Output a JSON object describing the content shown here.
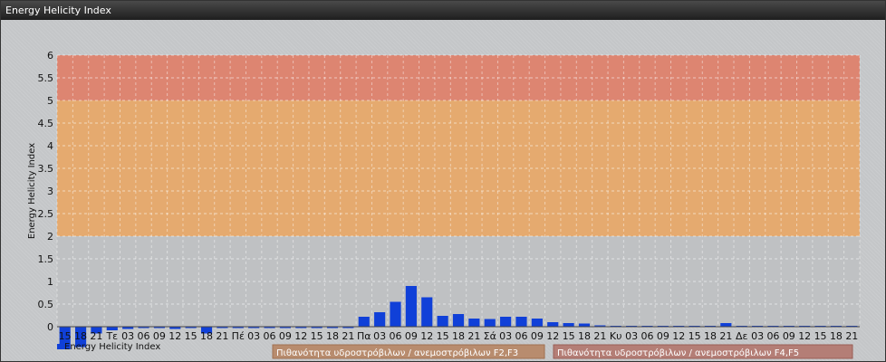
{
  "window": {
    "title": "Energy Helicity Index"
  },
  "chart_data": {
    "type": "bar",
    "ylabel": "Energy Helicity Index",
    "ylim": [
      0,
      6
    ],
    "yticks": [
      "0",
      "0.5",
      "1",
      "1.5",
      "2",
      "2.5",
      "3",
      "3.5",
      "4",
      "4.5",
      "5",
      "5.5",
      "6"
    ],
    "categories": [
      "15",
      "18",
      "21",
      "Τε",
      "03",
      "06",
      "09",
      "12",
      "15",
      "18",
      "21",
      "Πέ",
      "03",
      "06",
      "09",
      "12",
      "15",
      "18",
      "21",
      "Πα",
      "03",
      "06",
      "09",
      "12",
      "15",
      "18",
      "21",
      "Σά",
      "03",
      "06",
      "09",
      "12",
      "15",
      "18",
      "21",
      "Κυ",
      "03",
      "06",
      "09",
      "12",
      "15",
      "18",
      "21",
      "Δε",
      "03",
      "06",
      "09",
      "12",
      "15",
      "18",
      "21"
    ],
    "series": [
      {
        "name": "Energy Helicity Index",
        "color": "#1040d8",
        "values": [
          -0.5,
          -0.45,
          -0.15,
          -0.08,
          -0.05,
          -0.03,
          -0.02,
          -0.05,
          -0.03,
          -0.15,
          -0.03,
          -0.03,
          -0.02,
          -0.02,
          -0.02,
          -0.02,
          -0.02,
          -0.02,
          -0.02,
          0.22,
          0.32,
          0.55,
          0.9,
          0.65,
          0.24,
          0.28,
          0.18,
          0.17,
          0.22,
          0.22,
          0.18,
          0.1,
          0.08,
          0.07,
          0.03,
          0.02,
          0.02,
          0.02,
          0.02,
          0.02,
          0.02,
          0.02,
          0.08,
          0.02,
          0.02,
          0.02,
          0.02,
          0.02,
          0.02,
          0.02,
          0.02
        ]
      }
    ],
    "bands": [
      {
        "from": 2,
        "to": 5,
        "color": "#e8a868",
        "label": "Πιθανότητα υδροστρόβιλων / ανεμοστρόβιλων F2,F3"
      },
      {
        "from": 5,
        "to": 6,
        "color": "#e0806a",
        "label": "Πιθανότητα υδροστρόβιλων / ανεμοστρόβιλων F4,F5"
      }
    ],
    "grid": true,
    "legend_position": "bottom"
  }
}
